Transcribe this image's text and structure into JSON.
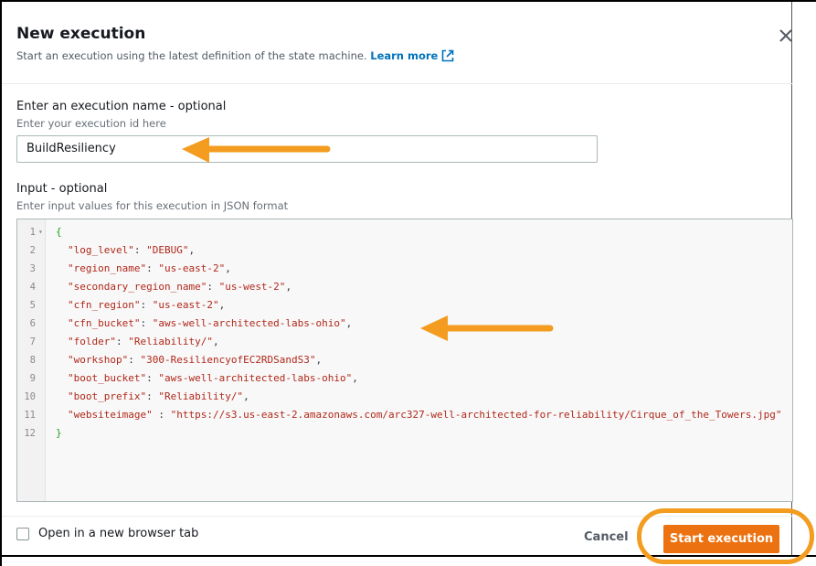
{
  "modal": {
    "title": "New execution",
    "subtitle": "Start an execution using the latest definition of the state machine.",
    "learn_more": "Learn more",
    "close_icon": "close-icon",
    "external_icon": "external-link-icon"
  },
  "name_field": {
    "label": "Enter an execution name - optional",
    "description": "Enter your execution id here",
    "value": "BuildResiliency"
  },
  "input_field": {
    "label": "Input - optional",
    "description": "Enter input values for this execution in JSON format",
    "lines": [
      {
        "num": "1",
        "open": "{"
      },
      {
        "num": "2",
        "key": "\"log_level\"",
        "value": "\"DEBUG\"",
        "comma": ","
      },
      {
        "num": "3",
        "key": "\"region_name\"",
        "value": "\"us-east-2\"",
        "comma": ","
      },
      {
        "num": "4",
        "key": "\"secondary_region_name\"",
        "value": "\"us-west-2\"",
        "comma": ","
      },
      {
        "num": "5",
        "key": "\"cfn_region\"",
        "value": "\"us-east-2\"",
        "comma": ","
      },
      {
        "num": "6",
        "key": "\"cfn_bucket\"",
        "value": "\"aws-well-architected-labs-ohio\"",
        "comma": ","
      },
      {
        "num": "7",
        "key": "\"folder\"",
        "value": "\"Reliability/\"",
        "comma": ","
      },
      {
        "num": "8",
        "key": "\"workshop\"",
        "value": "\"300-ResiliencyofEC2RDSandS3\"",
        "comma": ","
      },
      {
        "num": "9",
        "key": "\"boot_bucket\"",
        "value": "\"aws-well-architected-labs-ohio\"",
        "comma": ","
      },
      {
        "num": "10",
        "key": "\"boot_prefix\"",
        "value": "\"Reliability/\"",
        "comma": ","
      },
      {
        "num": "11",
        "key": "\"websiteimage\" ",
        "value": "\"https://s3.us-east-2.amazonaws.com/arc327-well-architected-for-reliability/Cirque_of_the_Towers.jpg\"",
        "comma": ""
      },
      {
        "num": "12",
        "close": "}"
      }
    ]
  },
  "footer": {
    "checkbox_label": "Open in a new browser tab",
    "checkbox_checked": false,
    "cancel_label": "Cancel",
    "start_label": "Start execution"
  },
  "colors": {
    "primary_button": "#ec7211",
    "annotation": "#f39c1f",
    "link": "#0073bb",
    "json_brace": "#1fa21f",
    "json_string": "#b0281a"
  },
  "annotations": [
    "arrow-annotation-name",
    "arrow-annotation-input",
    "highlight-ring-start"
  ]
}
